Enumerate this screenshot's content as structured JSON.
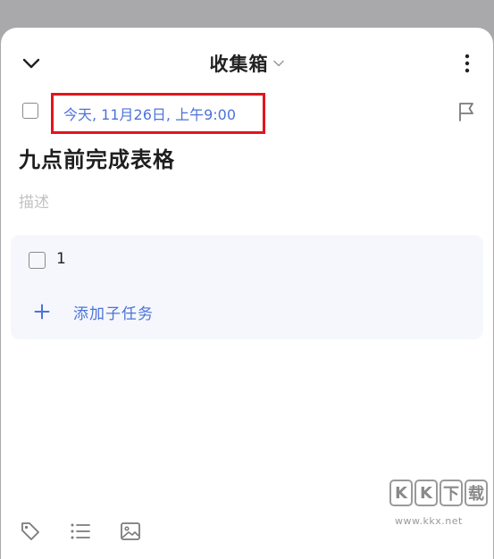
{
  "header": {
    "title": "收集箱",
    "collapse_icon": "chevron-down-icon",
    "title_dropdown_icon": "chevron-down-icon",
    "more_icon": "more-vertical-icon"
  },
  "task": {
    "due_date": "今天, 11月26日, 上午9:00",
    "title": "九点前完成表格",
    "description_placeholder": "描述",
    "flag_icon": "flag-icon"
  },
  "subtasks": {
    "items": [
      {
        "text": "1",
        "checked": false
      }
    ],
    "add_label": "添加子任务"
  },
  "toolbar": {
    "icons": [
      "tag-icon",
      "list-icon",
      "image-icon"
    ]
  },
  "watermark": {
    "letters": [
      "K",
      "K",
      "下",
      "载"
    ],
    "url": "www.kkx.net"
  },
  "colors": {
    "accent": "#4d72d9",
    "highlight_border": "#e3141c",
    "panel_bg": "#f5f7fd",
    "backdrop": "#a9a9ab"
  }
}
